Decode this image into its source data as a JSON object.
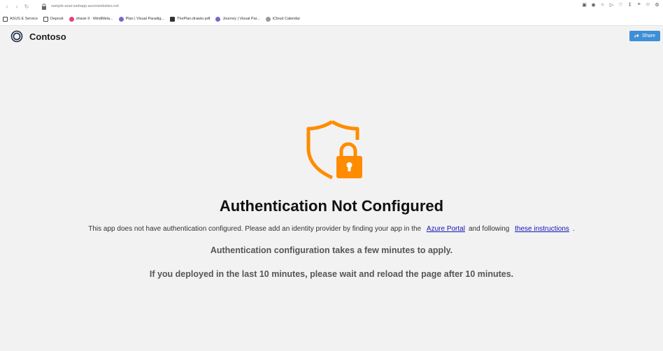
{
  "browser": {
    "url": "sample-aoai-webapp.azurewebsites.net",
    "bookmarks": [
      {
        "label": "ASUS E Service",
        "color": "#444444"
      },
      {
        "label": "Deposit",
        "color": "#444444"
      },
      {
        "label": "shaoe II · MindMela...",
        "color": "#e5407a"
      },
      {
        "label": "Plan | Visual Paradig...",
        "color": "#7a66c9"
      },
      {
        "label": "ThePlan.drawio.pdf",
        "color": "#333333"
      },
      {
        "label": "Journey | Visual Par...",
        "color": "#7a66c9"
      },
      {
        "label": "iCloud Calendar",
        "color": "#999999"
      }
    ]
  },
  "header": {
    "brand": "Contoso",
    "share_label": "Share"
  },
  "main": {
    "title": "Authentication Not Configured",
    "desc_before": "This app does not have authentication configured. Please add an identity provider by finding your app in the",
    "azure_portal_link": "Azure Portal",
    "desc_middle": "and following",
    "instructions_link": "these instructions",
    "desc_end": ".",
    "line2": "Authentication configuration takes a few minutes to apply.",
    "line3": "If you deployed in the last 10 minutes, please wait and reload the page after 10 minutes."
  },
  "colors": {
    "accent_orange": "#ff8c00",
    "link_blue": "#1414b8",
    "share_blue": "#3d8fd6"
  }
}
